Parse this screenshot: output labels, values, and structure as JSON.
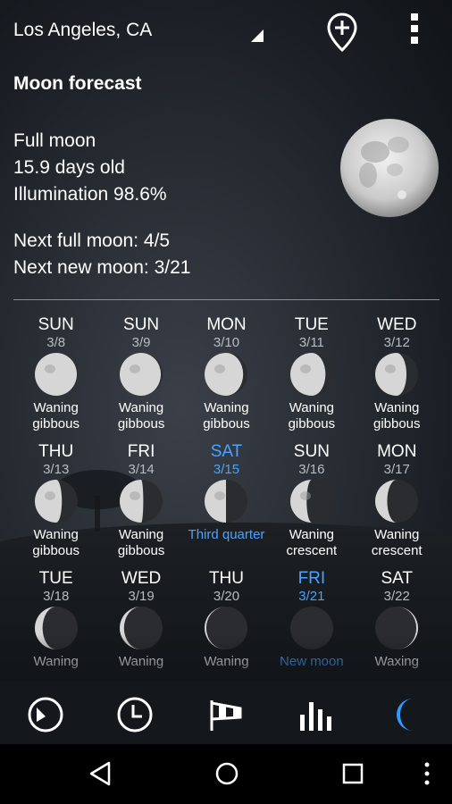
{
  "header": {
    "location": "Los Angeles, CA",
    "icons": [
      "dropdown-triangle-icon",
      "add-location-icon",
      "overflow-menu-icon"
    ]
  },
  "section_title": "Moon forecast",
  "current": {
    "phase": "Full moon",
    "age": "15.9 days old",
    "illumination": "Illumination 98.6%",
    "next_full": "Next full moon: 4/5",
    "next_new": "Next new moon: 3/21"
  },
  "forecast": [
    {
      "day": "SUN",
      "date": "3/8",
      "phase": "Waning gibbous",
      "illum": 0.98,
      "waxing": false,
      "highlight": false
    },
    {
      "day": "SUN",
      "date": "3/9",
      "phase": "Waning gibbous",
      "illum": 0.96,
      "waxing": false,
      "highlight": false
    },
    {
      "day": "MON",
      "date": "3/10",
      "phase": "Waning gibbous",
      "illum": 0.9,
      "waxing": false,
      "highlight": false
    },
    {
      "day": "TUE",
      "date": "3/11",
      "phase": "Waning gibbous",
      "illum": 0.82,
      "waxing": false,
      "highlight": false
    },
    {
      "day": "WED",
      "date": "3/12",
      "phase": "Waning gibbous",
      "illum": 0.73,
      "waxing": false,
      "highlight": false
    },
    {
      "day": "THU",
      "date": "3/13",
      "phase": "Waning gibbous",
      "illum": 0.63,
      "waxing": false,
      "highlight": false
    },
    {
      "day": "FRI",
      "date": "3/14",
      "phase": "Waning gibbous",
      "illum": 0.55,
      "waxing": false,
      "highlight": false
    },
    {
      "day": "SAT",
      "date": "3/15",
      "phase": "Third quarter",
      "illum": 0.5,
      "waxing": false,
      "highlight": true
    },
    {
      "day": "SUN",
      "date": "3/16",
      "phase": "Waning crescent",
      "illum": 0.38,
      "waxing": false,
      "highlight": false
    },
    {
      "day": "MON",
      "date": "3/17",
      "phase": "Waning crescent",
      "illum": 0.28,
      "waxing": false,
      "highlight": false
    },
    {
      "day": "TUE",
      "date": "3/18",
      "phase": "Waning",
      "illum": 0.18,
      "waxing": false,
      "highlight": false
    },
    {
      "day": "WED",
      "date": "3/19",
      "phase": "Waning",
      "illum": 0.1,
      "waxing": false,
      "highlight": false
    },
    {
      "day": "THU",
      "date": "3/20",
      "phase": "Waning",
      "illum": 0.04,
      "waxing": false,
      "highlight": false
    },
    {
      "day": "FRI",
      "date": "3/21",
      "phase": "New moon",
      "illum": 0.0,
      "waxing": true,
      "highlight": true
    },
    {
      "day": "SAT",
      "date": "3/22",
      "phase": "Waxing",
      "illum": 0.04,
      "waxing": true,
      "highlight": false
    }
  ],
  "tabs": [
    {
      "name": "tab-daily-forecast",
      "icon": "sector-gauge-icon",
      "active": false
    },
    {
      "name": "tab-hourly",
      "icon": "clock-icon",
      "active": false
    },
    {
      "name": "tab-wind",
      "icon": "windsock-icon",
      "active": false
    },
    {
      "name": "tab-charts",
      "icon": "bar-chart-icon",
      "active": false
    },
    {
      "name": "tab-moon",
      "icon": "crescent-moon-icon",
      "active": true
    }
  ],
  "colors": {
    "accent": "#2f9bff",
    "highlight": "#4aa3ff",
    "nav": "#000000"
  }
}
